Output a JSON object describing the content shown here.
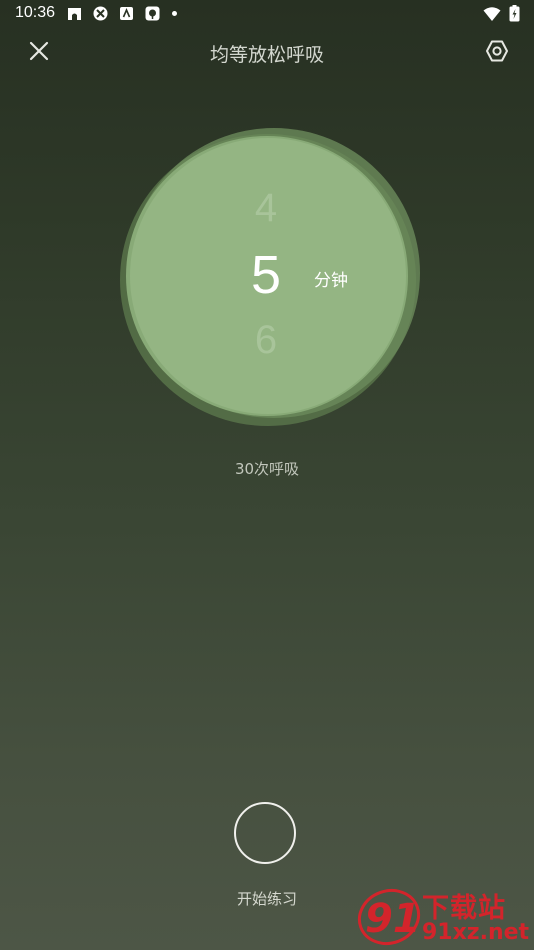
{
  "status_bar": {
    "time": "10:36",
    "left_icons": [
      "app-icon-1",
      "app-icon-2",
      "app-icon-3",
      "app-icon-4",
      "notification-dot"
    ],
    "right_icons": [
      "wifi-icon",
      "battery-icon"
    ]
  },
  "header": {
    "title": "均等放松呼吸",
    "close_icon": "close-icon",
    "settings_icon": "settings-icon"
  },
  "picker": {
    "prev_value": "4",
    "current_value": "5",
    "next_value": "6",
    "unit": "分钟"
  },
  "breath_count": "30次呼吸",
  "start": {
    "label": "开始练习"
  },
  "watermark": {
    "logo": "91",
    "top_text": "下载站",
    "bottom_text": "91xz.net"
  },
  "colors": {
    "background_top": "#273022",
    "background_bottom": "#4d5646",
    "circle": "#94b583",
    "watermark": "#d3242b"
  }
}
